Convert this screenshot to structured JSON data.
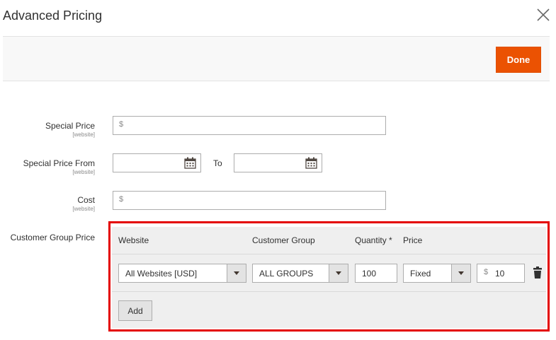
{
  "modal": {
    "title": "Advanced Pricing",
    "done_label": "Done"
  },
  "form": {
    "special_price": {
      "label": "Special Price",
      "scope": "[website]",
      "currency": "$",
      "value": ""
    },
    "special_price_from": {
      "label": "Special Price From",
      "scope": "[website]",
      "from_value": "",
      "to_label": "To",
      "to_value": ""
    },
    "cost": {
      "label": "Cost",
      "scope": "[website]",
      "currency": "$",
      "value": ""
    },
    "customer_group_price": {
      "label": "Customer Group Price"
    }
  },
  "tier_grid": {
    "headers": {
      "website": "Website",
      "customer_group": "Customer Group",
      "quantity": "Quantity",
      "required_mark": "*",
      "price": "Price"
    },
    "rows": [
      {
        "website": "All Websites [USD]",
        "customer_group": "ALL GROUPS",
        "quantity": "100",
        "price_type": "Fixed",
        "currency": "$",
        "price": "10"
      }
    ],
    "add_label": "Add"
  },
  "colors": {
    "accent": "#eb5202",
    "highlight": "#e40000",
    "required": "#e22626"
  },
  "icons": {
    "close": "close-icon",
    "calendar": "calendar-icon",
    "dropdown": "chevron-down-icon",
    "delete": "trash-icon"
  }
}
